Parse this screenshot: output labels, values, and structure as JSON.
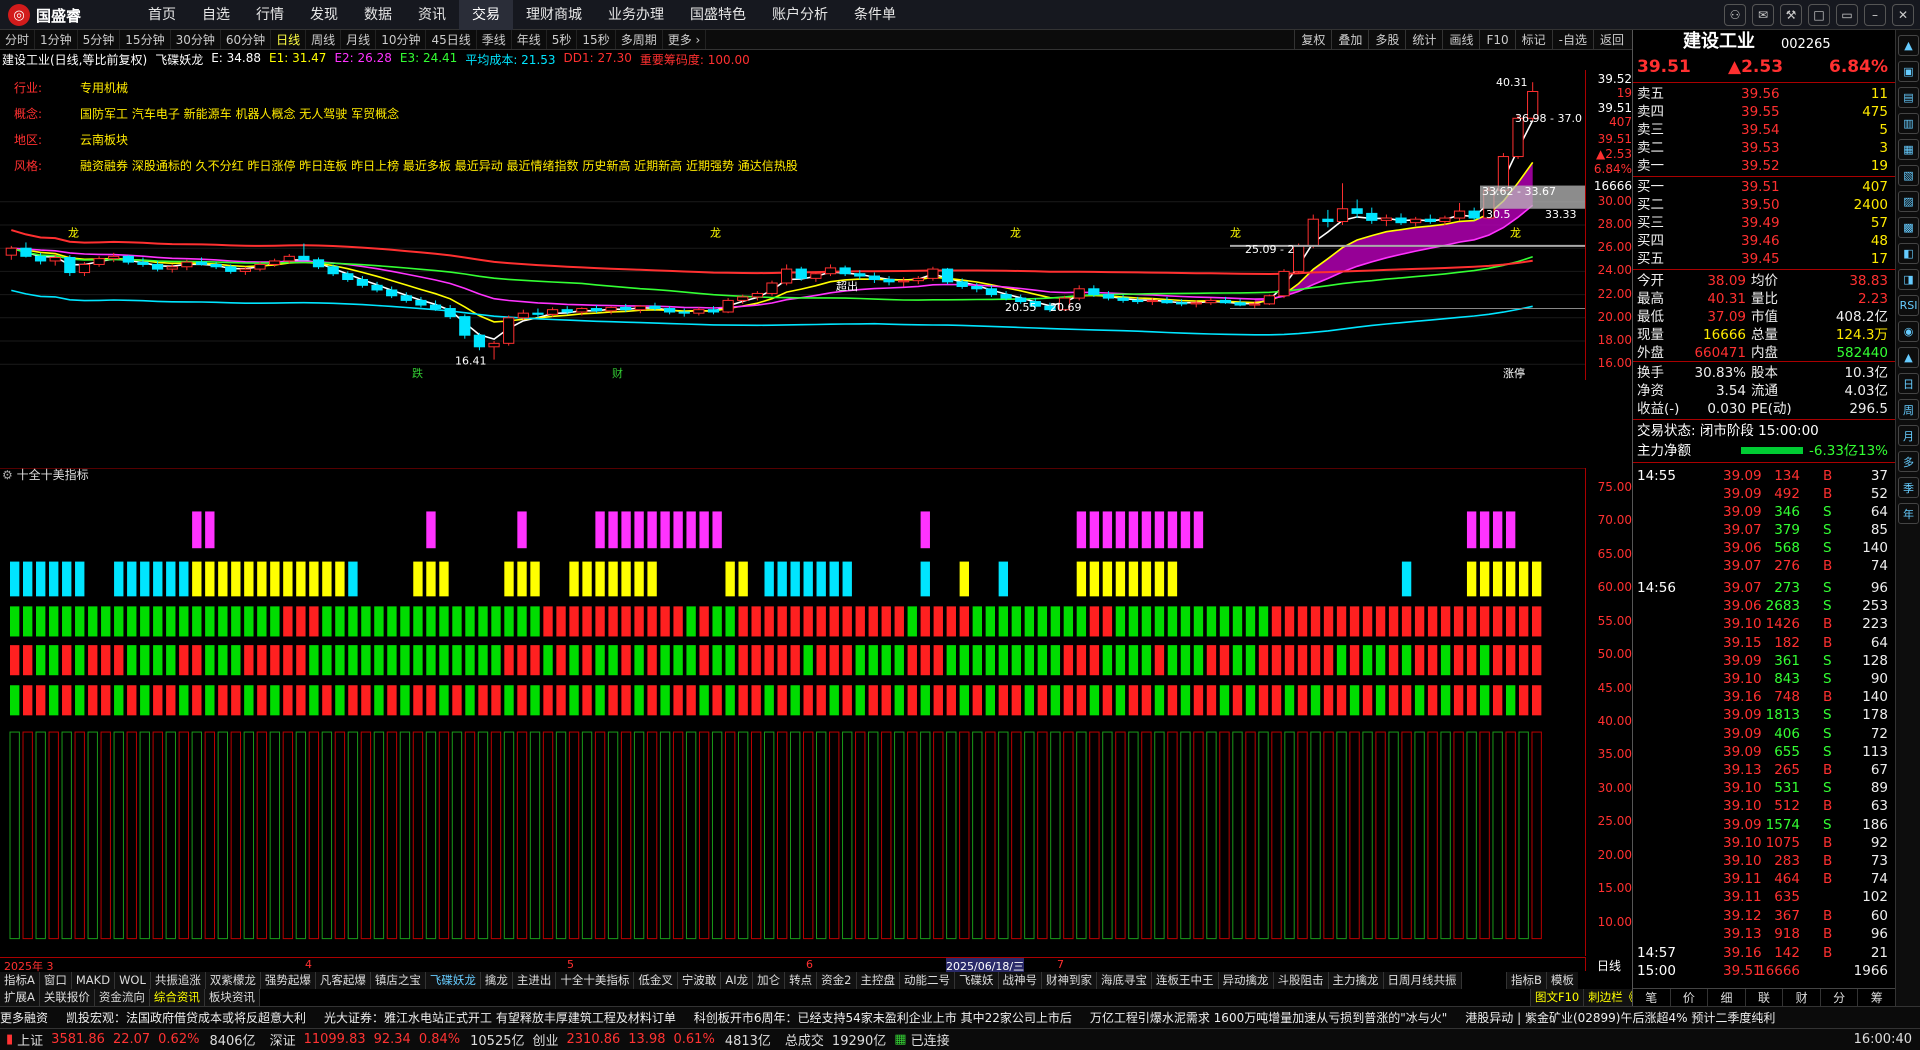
{
  "app": {
    "logo_text": "国盛睿"
  },
  "menu": [
    "首页",
    "自选",
    "行情",
    "发现",
    "数据",
    "资讯",
    "交易",
    "理财商城",
    "业务办理",
    "国盛特色",
    "账户分析",
    "条件单"
  ],
  "menu_active": 6,
  "window_controls": [
    "⚇",
    "✉",
    "⚒",
    "□",
    "▭",
    "–",
    "✕"
  ],
  "periods": [
    "分时",
    "1分钟",
    "5分钟",
    "15分钟",
    "30分钟",
    "60分钟",
    "日线",
    "周线",
    "月线",
    "10分钟",
    "45日线",
    "季线",
    "年线",
    "5秒",
    "15秒",
    "多周期",
    "更多 ›"
  ],
  "period_selected": 6,
  "toolbar": [
    "复权",
    "叠加",
    "多股",
    "统计",
    "画线",
    "F10",
    "标记",
    "-自选",
    "返回"
  ],
  "kline_header": {
    "name": "建设工业(日线,等比前复权)",
    "indicator": "飞碟妖龙",
    "items": [
      {
        "label": "E:",
        "value": "34.88",
        "color": "#ffffff"
      },
      {
        "label": "E1:",
        "value": "31.47",
        "color": "#ffff00"
      },
      {
        "label": "E2:",
        "value": "26.28",
        "color": "#ff33ff"
      },
      {
        "label": "E3:",
        "value": "24.41",
        "color": "#33ff33"
      },
      {
        "label": "平均成本:",
        "value": "21.53",
        "color": "#00e5ff"
      },
      {
        "label": "DD1:",
        "value": "27.30",
        "color": "#ff3030"
      },
      {
        "label": "重要筹码度:",
        "value": "100.00",
        "color": "#ff3030"
      }
    ]
  },
  "stock_info": [
    {
      "label": "行业:",
      "value": "专用机械"
    },
    {
      "label": "概念:",
      "value": "国防军工 汽车电子 新能源车 机器人概念 无人驾驶 军贸概念"
    },
    {
      "label": "地区:",
      "value": "云南板块"
    },
    {
      "label": "风格:",
      "value": "融资融券 深股通标的 久不分红 昨日涨停 昨日连板 昨日上榜 最近多板 最近异动 最近情绪指数 历史新高 近期新高 近期强势 通达信热股"
    }
  ],
  "chart_labels": {
    "high_price": "40.31",
    "low_price": "16.41",
    "mid_low": "20.55",
    "mid_low2": "20.69",
    "price_box": "33.62 - 33.67",
    "right_p1": "36.98 - 37.0",
    "right_p2": "33.33",
    "right_p3": "30.5",
    "mid_p": "25.09 - 2",
    "event_die": "跌",
    "event_cai": "财",
    "event_zt": "涨停",
    "event_mid": "超出",
    "long_tag": "龙"
  },
  "chart_data": {
    "type": "candlestick",
    "ylim": [
      15.5,
      40.5
    ],
    "yticks": [
      "16.00",
      "18.00",
      "20.00",
      "22.00",
      "24.00",
      "26.00",
      "28.00",
      "30.00"
    ],
    "ohlc": [
      [
        25.4,
        26.2,
        25.0,
        26.0
      ],
      [
        26.0,
        26.5,
        25.2,
        25.3
      ],
      [
        25.3,
        25.6,
        24.6,
        24.9
      ],
      [
        24.9,
        25.5,
        24.5,
        25.2
      ],
      [
        25.2,
        25.4,
        23.6,
        23.9
      ],
      [
        23.9,
        24.8,
        23.6,
        24.6
      ],
      [
        24.6,
        25.3,
        24.4,
        25.1
      ],
      [
        25.1,
        25.6,
        24.8,
        25.3
      ],
      [
        25.3,
        25.4,
        24.6,
        24.8
      ],
      [
        24.8,
        25.2,
        24.4,
        24.6
      ],
      [
        24.6,
        24.9,
        24.0,
        24.2
      ],
      [
        24.2,
        24.6,
        23.9,
        24.4
      ],
      [
        24.4,
        25.0,
        24.1,
        24.8
      ],
      [
        24.8,
        25.2,
        24.5,
        24.6
      ],
      [
        24.6,
        24.8,
        24.2,
        24.4
      ],
      [
        24.4,
        24.6,
        23.8,
        24.0
      ],
      [
        24.0,
        24.4,
        23.7,
        24.2
      ],
      [
        24.2,
        24.8,
        24.0,
        24.6
      ],
      [
        24.6,
        25.1,
        24.4,
        24.9
      ],
      [
        24.9,
        25.5,
        24.7,
        25.3
      ],
      [
        25.3,
        26.4,
        25.1,
        25.0
      ],
      [
        25.0,
        25.2,
        24.2,
        24.4
      ],
      [
        24.4,
        24.6,
        23.6,
        23.8
      ],
      [
        23.8,
        24.0,
        23.1,
        23.3
      ],
      [
        23.3,
        23.6,
        22.6,
        22.8
      ],
      [
        22.8,
        23.1,
        22.2,
        22.4
      ],
      [
        22.4,
        22.7,
        21.7,
        21.9
      ],
      [
        21.9,
        22.2,
        21.3,
        21.5
      ],
      [
        21.5,
        21.8,
        20.9,
        21.1
      ],
      [
        21.1,
        21.5,
        20.6,
        20.8
      ],
      [
        20.8,
        21.1,
        19.9,
        20.1
      ],
      [
        20.1,
        20.3,
        18.2,
        18.5
      ],
      [
        18.5,
        18.7,
        17.2,
        17.5
      ],
      [
        17.5,
        18.0,
        16.4,
        17.8
      ],
      [
        17.8,
        20.2,
        17.6,
        20.0
      ],
      [
        20.0,
        20.7,
        19.8,
        20.4
      ],
      [
        20.4,
        20.8,
        20.0,
        20.3
      ],
      [
        20.3,
        20.9,
        20.1,
        20.7
      ],
      [
        20.7,
        21.0,
        20.3,
        20.5
      ],
      [
        20.5,
        20.9,
        20.2,
        20.8
      ],
      [
        20.8,
        21.1,
        20.4,
        20.6
      ],
      [
        20.6,
        21.0,
        20.3,
        20.9
      ],
      [
        20.9,
        21.2,
        20.5,
        20.7
      ],
      [
        20.7,
        21.1,
        20.4,
        21.0
      ],
      [
        21.0,
        21.3,
        20.6,
        20.8
      ],
      [
        20.8,
        21.0,
        20.3,
        20.5
      ],
      [
        20.5,
        20.8,
        20.1,
        20.4
      ],
      [
        20.4,
        20.9,
        20.2,
        20.7
      ],
      [
        20.7,
        21.0,
        20.3,
        20.5
      ],
      [
        20.5,
        21.7,
        20.4,
        21.5
      ],
      [
        21.5,
        22.0,
        21.2,
        21.8
      ],
      [
        21.8,
        22.3,
        21.5,
        22.1
      ],
      [
        22.1,
        23.2,
        21.9,
        23.0
      ],
      [
        23.0,
        24.6,
        22.8,
        24.2
      ],
      [
        24.2,
        24.4,
        23.2,
        23.4
      ],
      [
        23.4,
        24.0,
        23.1,
        23.8
      ],
      [
        23.8,
        24.6,
        23.6,
        24.3
      ],
      [
        24.3,
        24.5,
        23.6,
        23.8
      ],
      [
        23.8,
        24.1,
        23.3,
        23.6
      ],
      [
        23.6,
        23.9,
        23.0,
        23.3
      ],
      [
        23.3,
        23.6,
        22.8,
        23.1
      ],
      [
        23.1,
        23.5,
        22.7,
        23.2
      ],
      [
        23.2,
        23.6,
        22.9,
        23.4
      ],
      [
        23.4,
        24.4,
        23.2,
        24.2
      ],
      [
        24.2,
        24.3,
        22.9,
        23.1
      ],
      [
        23.1,
        23.4,
        22.5,
        22.7
      ],
      [
        22.7,
        23.0,
        22.2,
        22.5
      ],
      [
        22.5,
        22.8,
        21.8,
        22.0
      ],
      [
        22.0,
        22.3,
        21.5,
        21.7
      ],
      [
        21.7,
        22.0,
        21.2,
        21.4
      ],
      [
        21.4,
        21.7,
        20.8,
        21.0
      ],
      [
        21.0,
        21.3,
        20.5,
        20.7
      ],
      [
        20.7,
        21.9,
        20.6,
        21.7
      ],
      [
        21.7,
        22.8,
        21.5,
        22.5
      ],
      [
        22.5,
        22.8,
        21.8,
        22.0
      ],
      [
        22.0,
        22.3,
        21.5,
        21.7
      ],
      [
        21.7,
        22.0,
        21.3,
        21.5
      ],
      [
        21.5,
        21.8,
        21.2,
        21.4
      ],
      [
        21.4,
        21.7,
        21.1,
        21.5
      ],
      [
        21.5,
        21.8,
        21.2,
        21.3
      ],
      [
        21.3,
        21.6,
        21.0,
        21.2
      ],
      [
        21.2,
        21.5,
        20.9,
        21.3
      ],
      [
        21.3,
        21.7,
        21.1,
        21.5
      ],
      [
        21.5,
        21.8,
        21.2,
        21.3
      ],
      [
        21.3,
        21.6,
        21.0,
        21.1
      ],
      [
        21.1,
        21.4,
        20.8,
        21.2
      ],
      [
        21.2,
        22.0,
        21.1,
        21.9
      ],
      [
        21.9,
        24.2,
        21.7,
        24.0
      ],
      [
        24.0,
        26.4,
        23.8,
        26.2
      ],
      [
        26.2,
        28.9,
        26.0,
        28.5
      ],
      [
        28.5,
        29.3,
        27.8,
        28.3
      ],
      [
        28.3,
        31.6,
        28.0,
        29.4
      ],
      [
        29.4,
        30.2,
        28.6,
        29.0
      ],
      [
        29.0,
        29.5,
        28.1,
        28.4
      ],
      [
        28.4,
        28.9,
        27.9,
        28.6
      ],
      [
        28.6,
        29.0,
        28.0,
        28.2
      ],
      [
        28.2,
        28.7,
        27.9,
        28.5
      ],
      [
        28.5,
        28.9,
        28.1,
        28.3
      ],
      [
        28.3,
        28.8,
        28.0,
        28.6
      ],
      [
        28.6,
        29.9,
        28.4,
        29.2
      ],
      [
        29.2,
        29.5,
        28.4,
        28.6
      ],
      [
        28.6,
        31.3,
        28.5,
        31.0
      ],
      [
        31.0,
        34.2,
        30.8,
        33.9
      ],
      [
        33.9,
        37.5,
        33.7,
        37.2
      ],
      [
        37.2,
        40.31,
        37.0,
        39.51
      ]
    ],
    "ma_lines": [
      {
        "name": "E",
        "color": "#ffffff"
      },
      {
        "name": "E1",
        "color": "#ffff00"
      },
      {
        "name": "E2",
        "color": "#ff33ff"
      },
      {
        "name": "E3",
        "color": "#33ff33"
      },
      {
        "name": "平均成本",
        "color": "#00e5ff"
      },
      {
        "name": "DD1",
        "color": "#ff3030"
      }
    ]
  },
  "indicator": {
    "name": "十全十美指标",
    "yticks": [
      "75.00",
      "70.00",
      "65.00",
      "60.00",
      "55.00",
      "50.00",
      "45.00",
      "40.00",
      "35.00",
      "30.00",
      "25.00",
      "20.00",
      "15.00",
      "10.00"
    ],
    "magenta_rows": "000000000000000110000000000000000100000010000000000000111111000000000000000000000000000000000000000000000000000001000000000011111111100000000000000000000000000000000000000000000000000000000000000000000000000000001111",
    "row_cyan": "1111111000111111000000000000000000000000000000000000000000000000000000000000000000000000000000000000011111111111000000000000000000000000000000000000000000000000000000000000000000000000000000000000000000000000",
    "row_yellow": "0000000000000001111111111111111111111111111111111110000000000000000000000000000000000000000000000000000000000000000000000000000000000000000000000000000000000000000000000000000000000000000000000000000000000000",
    "bottom_label": "2025年 3"
  },
  "date_axis": [
    "2025年 3",
    "4",
    "5",
    "6",
    "2025/06/18/三",
    "7"
  ],
  "axis_corner": "日线",
  "tabs_row1": [
    "指标A",
    "窗口",
    "MAKD",
    "WOL",
    "共振追涨",
    "双紫檬龙",
    "强势起爆",
    "凡客起爆",
    "镇店之宝",
    "飞碟妖龙",
    "擒龙",
    "主进出",
    "十全十美指标",
    "低金叉",
    "宁波敢",
    "AI龙",
    "加仑",
    "转点",
    "资金2",
    "主控盘",
    "动能二号",
    "飞碟妖",
    "战神号",
    "财神到家",
    "海底寻宝",
    "连板王中王",
    "异动擒龙",
    "斗股阻击",
    "主力擒龙",
    "日周月线共振"
  ],
  "tabs_row1_right": [
    "指标B",
    "模板"
  ],
  "tabs_row2": [
    "扩展A",
    "关联报价",
    "资金流向",
    "综合资讯",
    "板块资讯"
  ],
  "tabs_row2_right": [
    "图文F10",
    "刺边栏《"
  ],
  "news": [
    "更多融资",
    "凯投宏观：法国政府借贷成本或将反超意大利",
    "光大证券：雅江水电站正式开工  有望释放丰厚建筑工程及材料订单",
    "科创板开市6周年：已经支持54家未盈利企业上市  其中22家公司上市后",
    "万亿工程引爆水泥需求  1600万吨增量加速从亏损到普涨的\"冰与火\"",
    "港股异动 | 紫金矿业(02899)午后涨超4%  预计二季度纯利"
  ],
  "statusbar": {
    "sh_label": "上证",
    "sh_val": "3581.86",
    "sh_chg": "22.07",
    "sh_pct": "0.62%",
    "sh_amt": "8406亿",
    "sz_label": "深证",
    "sz_val": "11099.83",
    "sz_chg": "92.34",
    "sz_pct": "0.84%",
    "sz_amt": "10525亿",
    "cy_label": "创业",
    "cy_val": "2310.86",
    "cy_chg": "13.98",
    "cy_pct": "0.61%",
    "cy_amt": "4813亿",
    "total_label": "总成交",
    "total_val": "19290亿",
    "conn": "已连接",
    "time": "16:00:40"
  },
  "quote": {
    "name": "建设工业",
    "code": "002265",
    "price": "39.51",
    "change": "▲2.53",
    "pct": "6.84%",
    "asks": [
      [
        "卖五",
        "39.56",
        "11"
      ],
      [
        "卖四",
        "39.55",
        "475"
      ],
      [
        "卖三",
        "39.54",
        "5"
      ],
      [
        "卖二",
        "39.53",
        "3"
      ],
      [
        "卖一",
        "39.52",
        "19"
      ]
    ],
    "bids": [
      [
        "买一",
        "39.51",
        "407"
      ],
      [
        "买二",
        "39.50",
        "2400"
      ],
      [
        "买三",
        "39.49",
        "57"
      ],
      [
        "买四",
        "39.46",
        "48"
      ],
      [
        "买五",
        "39.45",
        "17"
      ]
    ],
    "stats": [
      [
        "今开",
        "38.09",
        "均价",
        "38.83"
      ],
      [
        "最高",
        "40.31",
        "量比",
        "2.23"
      ],
      [
        "最低",
        "37.09",
        "市值",
        "408.2亿"
      ],
      [
        "现量",
        "16666",
        "总量",
        "124.3万"
      ],
      [
        "外盘",
        "660471",
        "内盘",
        "582440"
      ],
      [
        "换手",
        "30.83%",
        "股本",
        "10.3亿"
      ],
      [
        "净资",
        "3.54",
        "流通",
        "4.03亿"
      ],
      [
        "收益(-)",
        "0.030",
        "PE(动)",
        "296.5"
      ]
    ],
    "trade_state": "交易状态: 闭市阶段 15:00:00",
    "main_net_label": "主力净额",
    "main_net": "-6.33亿",
    "main_net_pct": "-13%",
    "ticks": [
      [
        "14:55",
        "39.09",
        "134",
        "B",
        "37"
      ],
      [
        "",
        "39.09",
        "492",
        "B",
        "52"
      ],
      [
        "",
        "39.09",
        "346",
        "S",
        "64"
      ],
      [
        "",
        "39.07",
        "379",
        "S",
        "85"
      ],
      [
        "",
        "39.06",
        "568",
        "S",
        "140"
      ],
      [
        "",
        "39.07",
        "276",
        "B",
        "74"
      ],
      [
        "14:56",
        "39.07",
        "273",
        "S",
        "96"
      ],
      [
        "",
        "39.06",
        "2683",
        "S",
        "253"
      ],
      [
        "",
        "39.10",
        "1426",
        "B",
        "223"
      ],
      [
        "",
        "39.15",
        "182",
        "B",
        "64"
      ],
      [
        "",
        "39.09",
        "361",
        "S",
        "128"
      ],
      [
        "",
        "39.10",
        "843",
        "S",
        "90"
      ],
      [
        "",
        "39.16",
        "748",
        "B",
        "140"
      ],
      [
        "",
        "39.09",
        "1813",
        "S",
        "178"
      ],
      [
        "",
        "39.09",
        "406",
        "S",
        "72"
      ],
      [
        "",
        "39.09",
        "655",
        "S",
        "113"
      ],
      [
        "",
        "39.13",
        "265",
        "B",
        "67"
      ],
      [
        "",
        "39.10",
        "531",
        "S",
        "89"
      ],
      [
        "",
        "39.10",
        "512",
        "B",
        "63"
      ],
      [
        "",
        "39.09",
        "1574",
        "S",
        "186"
      ],
      [
        "",
        "39.10",
        "1075",
        "B",
        "92"
      ],
      [
        "",
        "39.10",
        "283",
        "B",
        "73"
      ],
      [
        "",
        "39.11",
        "464",
        "B",
        "74"
      ],
      [
        "",
        "39.11",
        "635",
        "",
        "102"
      ],
      [
        "",
        "39.12",
        "367",
        "B",
        "60"
      ],
      [
        "",
        "39.13",
        "918",
        "B",
        "96"
      ],
      [
        "14:57",
        "39.16",
        "142",
        "B",
        "21"
      ],
      [
        "15:00",
        "39.51",
        "16666",
        "",
        "1966"
      ]
    ],
    "side_icons": [
      "▲",
      "▣",
      "▤",
      "▥",
      "▦",
      "▧",
      "▨",
      "▩",
      "◧",
      "◨",
      "RSI",
      "◉",
      "▲",
      "日",
      "周",
      "月",
      "多",
      "季",
      "年"
    ],
    "bottom_tabs": [
      "笔",
      "价",
      "细",
      "联",
      "财",
      "分",
      "筹"
    ]
  },
  "axis_right_labels": {
    "p1": "39.52",
    "p2": "19",
    "p3": "39.51",
    "p4": "407",
    "p5": "39.51",
    "p6": "▲2.53",
    "p7": "6.84%",
    "p8": "16666"
  }
}
